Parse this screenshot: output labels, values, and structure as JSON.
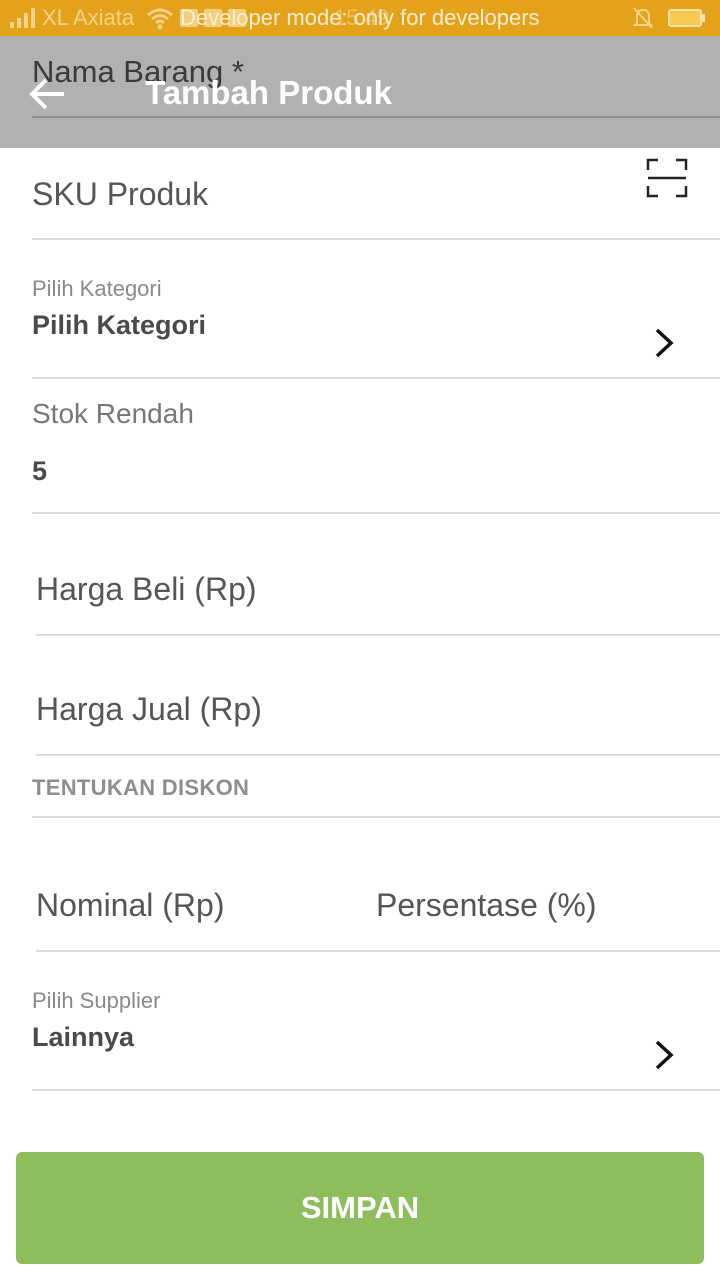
{
  "status_bar": {
    "carrier": "XL Axiata",
    "developer_notice": "Developer mode: only for developers",
    "time": "15:49",
    "icons": [
      "signal-icon",
      "wifi-icon",
      "notification-icons",
      "bell-off-icon",
      "battery-icon"
    ],
    "background_color": "#e3a21a"
  },
  "app_bar": {
    "title": "Tambah Produk",
    "back_icon": "arrow-left-icon",
    "underlying_label": "Nama Barang *",
    "background_color": "#b1b1b1"
  },
  "form": {
    "sku": {
      "placeholder": "SKU Produk",
      "scan_icon": "barcode-scan-icon"
    },
    "category": {
      "label": "Pilih Kategori",
      "value": "Pilih Kategori"
    },
    "low_stock": {
      "label": "Stok Rendah",
      "value": "5"
    },
    "buy_price": {
      "placeholder": "Harga Beli (Rp)"
    },
    "sell_price": {
      "placeholder": "Harga Jual (Rp)"
    },
    "discount": {
      "section_title": "TENTUKAN DISKON",
      "nominal_placeholder": "Nominal (Rp)",
      "percent_placeholder": "Persentase (%)"
    },
    "supplier": {
      "label": "Pilih Supplier",
      "value": "Lainnya"
    }
  },
  "save_button": {
    "label": "SIMPAN",
    "color": "#8ebd5b"
  }
}
